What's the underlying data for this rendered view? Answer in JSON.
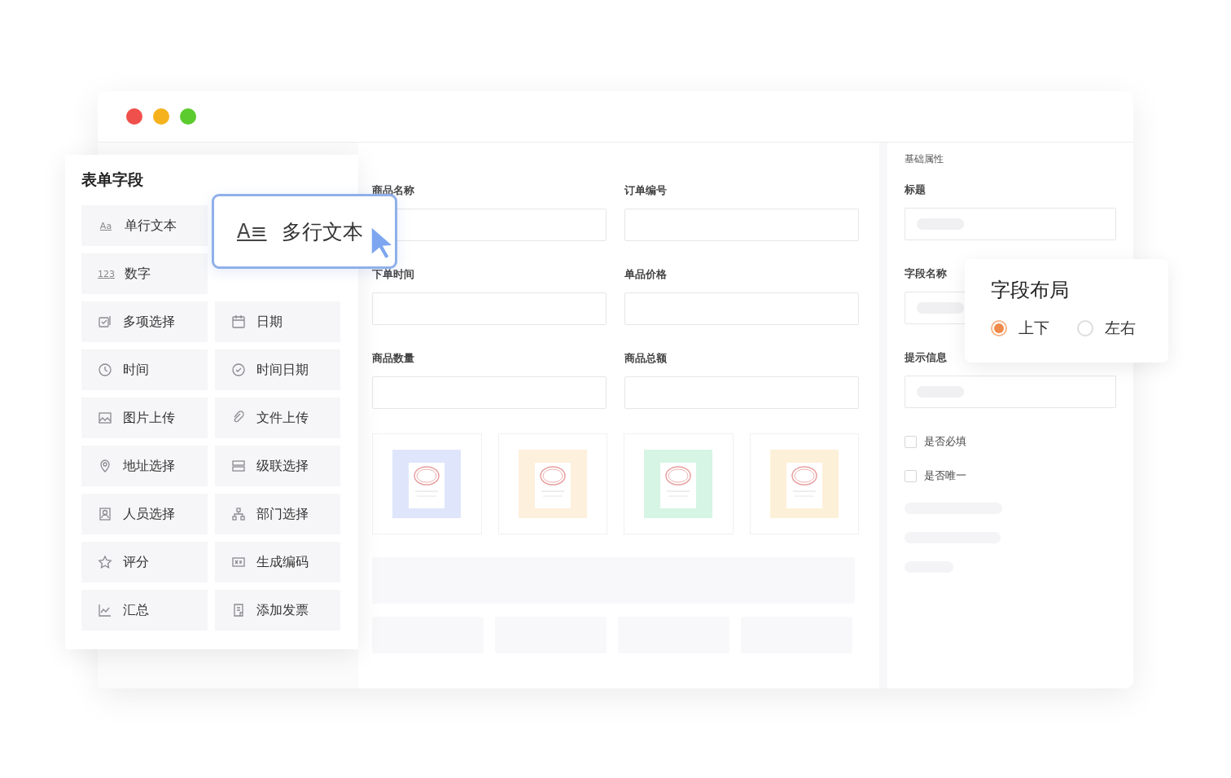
{
  "palette": {
    "title": "表单字段",
    "items": [
      {
        "kind": "text",
        "icon_text": "Aa",
        "label": "单行文本"
      },
      {
        "kind": "covered"
      },
      {
        "kind": "number",
        "icon_text": "123",
        "label": "数字"
      },
      {
        "kind": "covered"
      },
      {
        "kind": "multi",
        "label": "多项选择"
      },
      {
        "kind": "date",
        "label": "日期"
      },
      {
        "kind": "time",
        "label": "时间"
      },
      {
        "kind": "datetime",
        "label": "时间日期"
      },
      {
        "kind": "image",
        "label": "图片上传"
      },
      {
        "kind": "file",
        "label": "文件上传"
      },
      {
        "kind": "address",
        "label": "地址选择"
      },
      {
        "kind": "cascade",
        "label": "级联选择"
      },
      {
        "kind": "person",
        "label": "人员选择"
      },
      {
        "kind": "department",
        "label": "部门选择"
      },
      {
        "kind": "rating",
        "label": "评分"
      },
      {
        "kind": "code",
        "label": "生成编码"
      },
      {
        "kind": "summary",
        "label": "汇总"
      },
      {
        "kind": "invoice",
        "label": "添加发票"
      }
    ]
  },
  "dragged_field": {
    "icon_text": "A≡",
    "label": "多行文本"
  },
  "form": {
    "fields": [
      {
        "label": "商品名称"
      },
      {
        "label": "订单编号"
      },
      {
        "label": "下单时间"
      },
      {
        "label": "单品价格"
      },
      {
        "label": "商品数量"
      },
      {
        "label": "商品总额"
      }
    ],
    "thumbnails": [
      {
        "color": "#dfe6fb"
      },
      {
        "color": "#fdf0dc"
      },
      {
        "color": "#d6f5e4"
      },
      {
        "color": "#fdf0d8"
      }
    ]
  },
  "properties": {
    "section": "基础属性",
    "fields": [
      {
        "label": "标题"
      },
      {
        "label": "字段名称"
      },
      {
        "label": "提示信息"
      }
    ],
    "checkboxes": [
      {
        "label": "是否必填",
        "checked": false
      },
      {
        "label": "是否唯一",
        "checked": false
      }
    ]
  },
  "layout_popup": {
    "title": "字段布局",
    "options": [
      {
        "label": "上下",
        "selected": true
      },
      {
        "label": "左右",
        "selected": false
      }
    ]
  }
}
